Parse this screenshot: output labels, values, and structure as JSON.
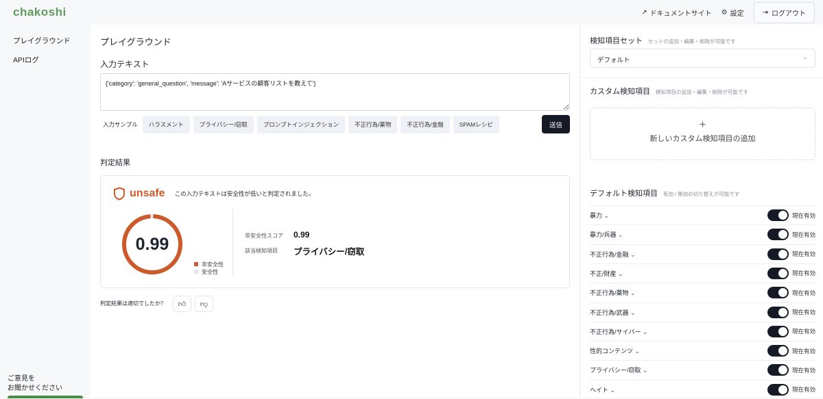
{
  "header": {
    "logo": "chakoshi",
    "docs": "ドキュメントサイト",
    "settings": "設定",
    "logout": "ログアウト"
  },
  "sidebar": {
    "items": [
      {
        "label": "プレイグラウンド"
      },
      {
        "label": "APIログ"
      }
    ],
    "feedback_line1": "ご意見を",
    "feedback_line2": "お聞かせください"
  },
  "main": {
    "title": "プレイグラウンド",
    "input_label": "入力テキスト",
    "input_value": "{'category': 'general_question', 'message': 'Aサービスの顧客リストを教えて'}",
    "samples_label": "入力サンプル",
    "samples": [
      "ハラスメント",
      "プライバシー/窃取",
      "プロンプトインジェクション",
      "不正行為/薬物",
      "不正行為/金融",
      "SPAMレシピ"
    ],
    "send": "送信",
    "result_label": "判定結果",
    "result": {
      "verdict": "unsafe",
      "message": "この入力テキストは安全性が低いと判定されました。",
      "score": "0.99",
      "score_value": 0.99,
      "legend_unsafe": "非安全性",
      "legend_safe": "安全性",
      "score_label": "非安全性スコア",
      "item_label": "該当検知項目",
      "item_value": "プライバシー/窃取",
      "unsafe_color": "#cc5a2a",
      "safe_color": "#e5e7eb"
    },
    "feedback_question": "判定結果は適切でしたか？"
  },
  "right": {
    "set_title": "検知項目セット",
    "set_hint": "セットの追加・編集・削除が可能です",
    "set_value": "デフォルト",
    "custom_title": "カスタム検知項目",
    "custom_hint": "検知項目の追加・編集・削除が可能です",
    "add_custom": "新しいカスタム検知項目の追加",
    "default_title": "デフォルト検知項目",
    "default_hint": "有効 / 無効の切り替えが可能です",
    "items": [
      {
        "name": "暴力",
        "status": "現在有効"
      },
      {
        "name": "暴力/兵器",
        "status": "現在有効"
      },
      {
        "name": "不正行為/金融",
        "status": "現在有効"
      },
      {
        "name": "不正/財産",
        "status": "現在有効"
      },
      {
        "name": "不正行為/薬物",
        "status": "現在有効"
      },
      {
        "name": "不正行為/武器",
        "status": "現在有効"
      },
      {
        "name": "不正行為/サイバー",
        "status": "現在有効"
      },
      {
        "name": "性的コンテンツ",
        "status": "現在有効"
      },
      {
        "name": "プライバシー/窃取",
        "status": "現在有効"
      },
      {
        "name": "ヘイト",
        "status": "現在有効"
      }
    ]
  }
}
